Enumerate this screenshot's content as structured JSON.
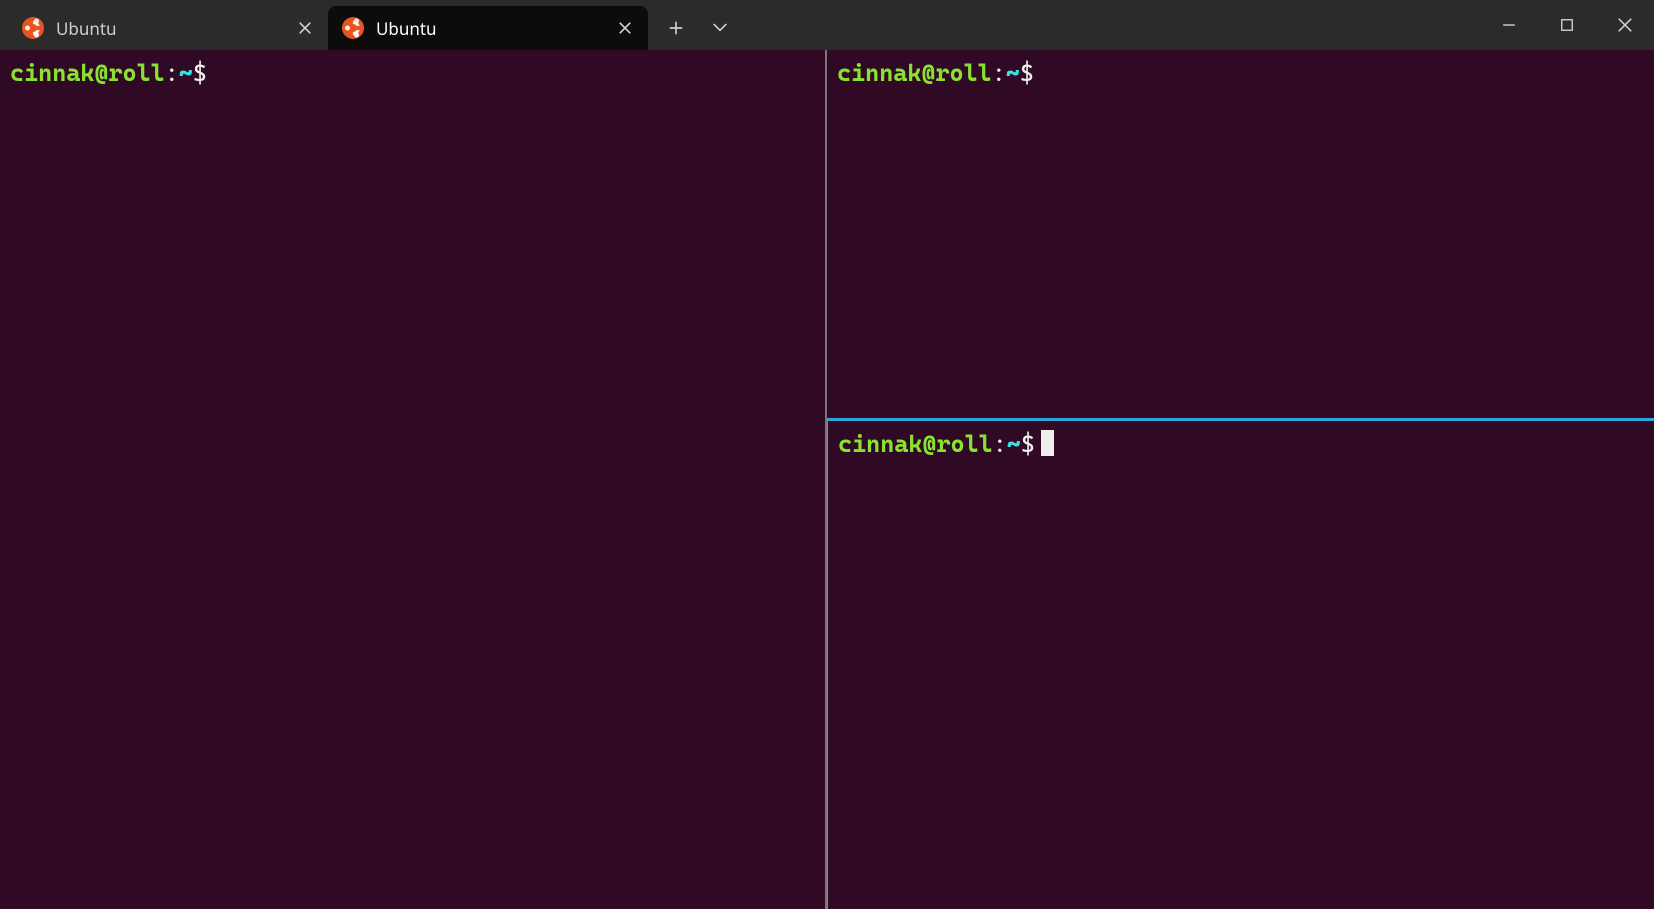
{
  "titlebar": {
    "tabs": [
      {
        "label": "Ubuntu",
        "active": false
      },
      {
        "label": "Ubuntu",
        "active": true
      }
    ]
  },
  "panes": {
    "left": {
      "prompt": {
        "user_host": "cinnak@roll",
        "sep": ":",
        "path": "~",
        "symbol": "$"
      },
      "has_cursor": false,
      "active": false
    },
    "right_top": {
      "prompt": {
        "user_host": "cinnak@roll",
        "sep": ":",
        "path": "~",
        "symbol": "$"
      },
      "has_cursor": false,
      "active": false
    },
    "right_bot": {
      "prompt": {
        "user_host": "cinnak@roll",
        "sep": ":",
        "path": "~",
        "symbol": "$"
      },
      "has_cursor": true,
      "active": true
    }
  }
}
